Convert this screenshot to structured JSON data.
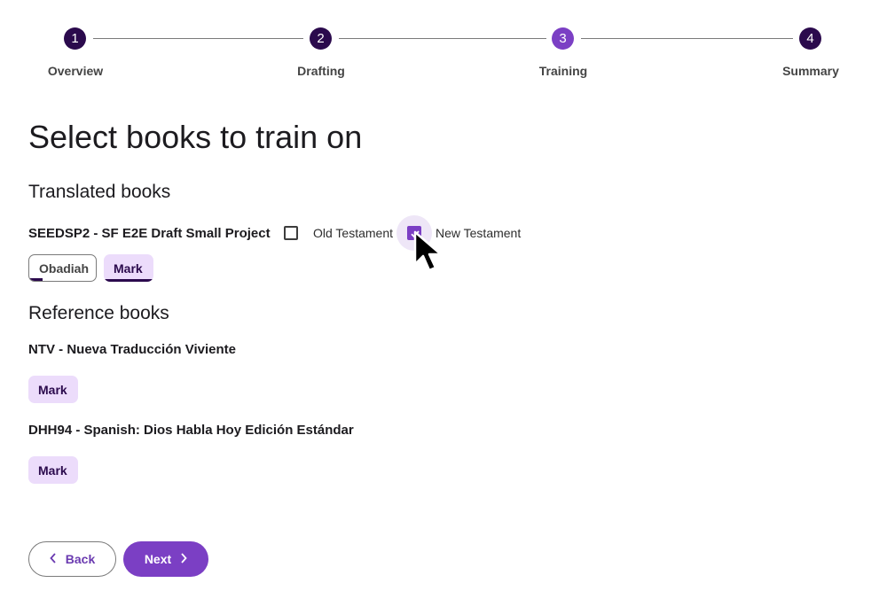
{
  "stepper": {
    "steps": [
      {
        "number": "1",
        "label": "Overview"
      },
      {
        "number": "2",
        "label": "Drafting"
      },
      {
        "number": "3",
        "label": "Training"
      },
      {
        "number": "4",
        "label": "Summary"
      }
    ],
    "active_step": 3
  },
  "title": "Select books to train on",
  "translated": {
    "heading": "Translated books",
    "project": "SEEDSP2 - SF E2E Draft Small Project",
    "old_testament": {
      "label": "Old Testament",
      "checked": false
    },
    "new_testament": {
      "label": "New Testament",
      "checked": true
    },
    "books": [
      {
        "label": "Obadiah",
        "selected": false,
        "progress": 0.2
      },
      {
        "label": "Mark",
        "selected": true,
        "progress": 1.0
      }
    ]
  },
  "reference": {
    "heading": "Reference books",
    "sources": [
      {
        "name": "NTV - Nueva Traducción Viviente",
        "books": [
          "Mark"
        ]
      },
      {
        "name": "DHH94 - Spanish: Dios Habla Hoy Edición Estándar",
        "books": [
          "Mark"
        ]
      }
    ]
  },
  "actions": {
    "back_label": "Back",
    "next_label": "Next"
  },
  "colors": {
    "accent": "#7b3fc4",
    "dark": "#2b0a4d",
    "chip_selected": "#ecdcfb"
  },
  "icons": {
    "back": "chevron-left-icon",
    "next": "chevron-right-icon",
    "cursor": "mouse-pointer-icon"
  }
}
